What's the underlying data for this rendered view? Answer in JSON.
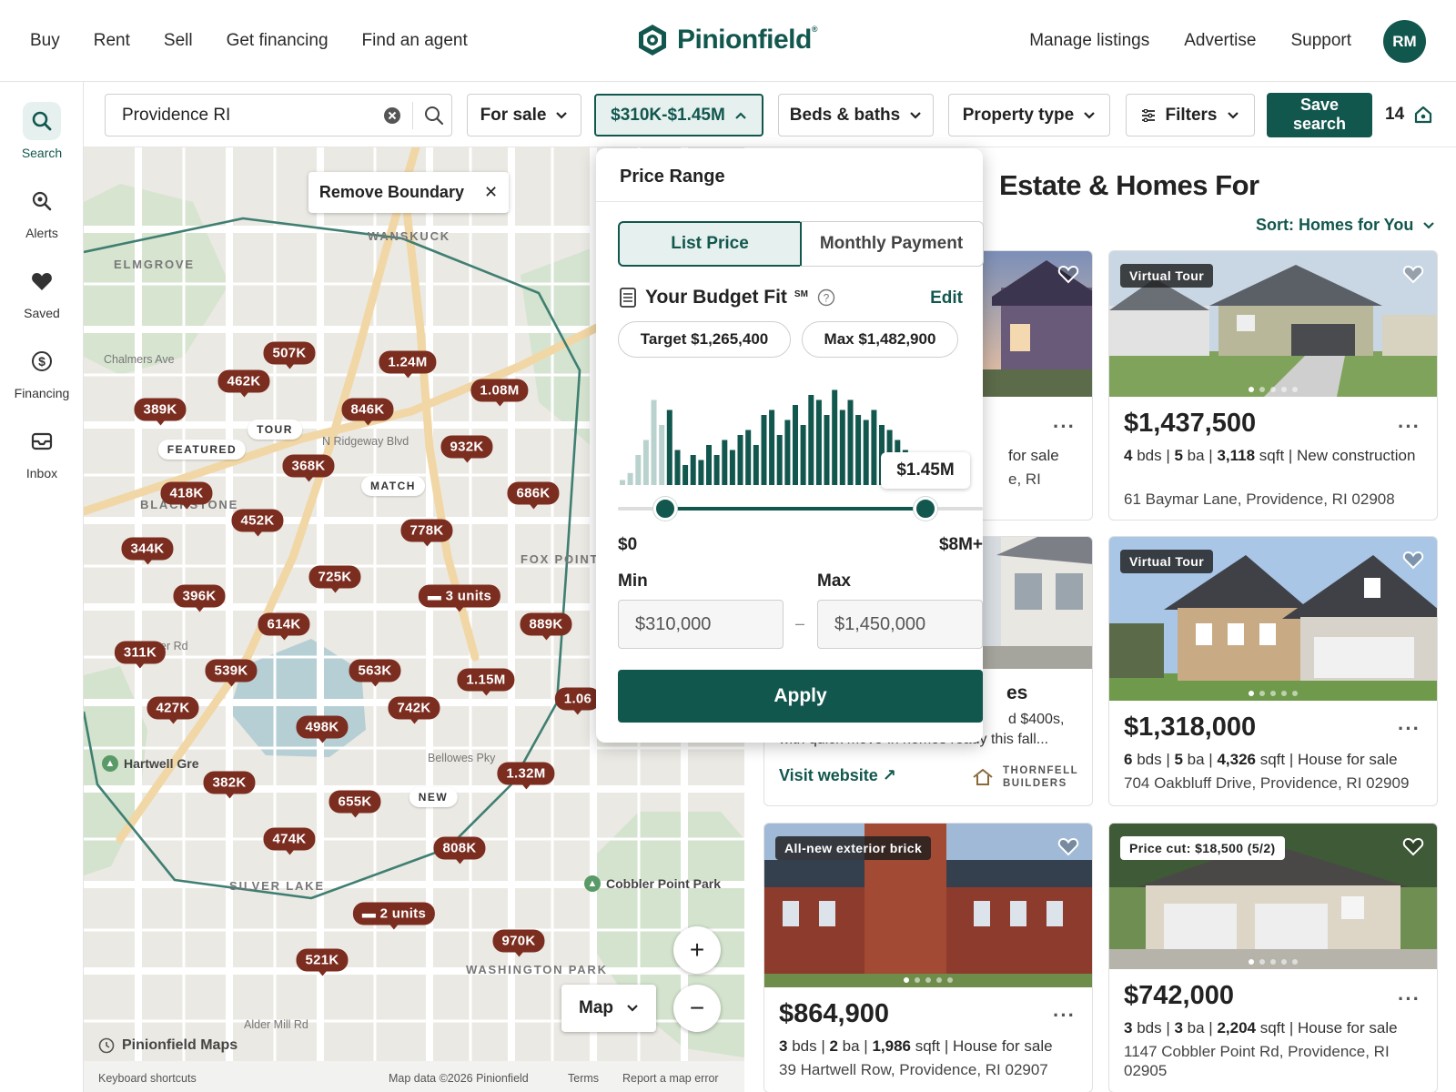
{
  "nav": {
    "left": [
      "Buy",
      "Rent",
      "Sell",
      "Get financing",
      "Find an agent"
    ],
    "right": [
      "Manage listings",
      "Advertise",
      "Support"
    ],
    "brand": "Pinionfield",
    "brand_mark": "®",
    "avatar_initials": "RM"
  },
  "rail": [
    {
      "label": "Search",
      "icon": "search-icon"
    },
    {
      "label": "Alerts",
      "icon": "alerts-icon"
    },
    {
      "label": "Saved",
      "icon": "heart-icon"
    },
    {
      "label": "Financing",
      "icon": "dollar-icon"
    },
    {
      "label": "Inbox",
      "icon": "inbox-icon"
    }
  ],
  "filters": {
    "search_value": "Providence RI",
    "for_sale": "For sale",
    "price": "$310K-$1.45M",
    "beds_baths": "Beds & baths",
    "property_type": "Property type",
    "filters": "Filters",
    "save_search_line1": "Save",
    "save_search_line2": "search",
    "result_count": "14"
  },
  "map": {
    "remove_boundary": "Remove Boundary",
    "map_type": "Map",
    "logo": "Pinionfield Maps",
    "footer": {
      "shortcuts": "Keyboard shortcuts",
      "data": "Map data ©2026 Pinionfield",
      "terms": "Terms",
      "report": "Report a map error"
    },
    "areas": [
      "ELMGROVE",
      "WANSKUCK",
      "BLACKSTONE",
      "FOX POINT",
      "SILVER LAKE",
      "WASHINGTON PARK"
    ],
    "streets": [
      "Chalmers Ave",
      "N Ridgeway Blvd",
      "Bellowes Pky",
      "Alder Mill Rd",
      "er Rd"
    ],
    "parks": [
      "Hartwell Gre",
      "Cobbler Point Park"
    ],
    "pins": [
      "507K",
      "462K",
      "1.24M",
      "1.08M",
      "389K",
      "846K",
      "932K",
      "368K",
      "686K",
      "418K",
      "452K",
      "778K",
      "344K",
      "725K",
      "3 units",
      "396K",
      "614K",
      "889K",
      "311K",
      "539K",
      "563K",
      "1.15M",
      "1.06",
      "427K",
      "742K",
      "498K",
      "1.32M",
      "382K",
      "655K",
      "474K",
      "808K",
      "2 units",
      "970K",
      "521K"
    ],
    "tags": [
      "TOUR",
      "FEATURED",
      "MATCH",
      "NEW"
    ]
  },
  "price_popover": {
    "title": "Price Range",
    "tab_list": "List Price",
    "tab_monthly": "Monthly Payment",
    "budget_label": "Your Budget Fit",
    "budget_sm": "SM",
    "edit": "Edit",
    "target": "Target $1,265,400",
    "max_chip": "Max $1,482,900",
    "tooltip": "$1.45M",
    "axis_min": "$0",
    "axis_max": "$8M+",
    "min_label": "Min",
    "max_label": "Max",
    "min_value": "$310,000",
    "max_value": "$1,450,000",
    "dash": "–",
    "apply": "Apply",
    "range_low_fraction": 0.129,
    "range_high_fraction": 0.842,
    "histogram": [
      0.05,
      0.12,
      0.3,
      0.45,
      0.85,
      0.6,
      0.75,
      0.35,
      0.2,
      0.3,
      0.25,
      0.4,
      0.3,
      0.45,
      0.35,
      0.5,
      0.55,
      0.4,
      0.7,
      0.75,
      0.5,
      0.65,
      0.8,
      0.6,
      0.9,
      0.85,
      0.7,
      0.95,
      0.75,
      0.85,
      0.7,
      0.65,
      0.75,
      0.6,
      0.55,
      0.45,
      0.35,
      0.3,
      0.2,
      0.15,
      0.1,
      0.08,
      0.06,
      0.05
    ]
  },
  "listings": {
    "heading": "Estate & Homes For",
    "sort": "Sort: Homes for You",
    "cards": [
      {
        "price": "",
        "facts": "for sale",
        "addr": "e, RI"
      },
      {
        "badge": "Virtual Tour",
        "price": "$1,437,500",
        "facts_b1": "4",
        "facts_t1": " bds | ",
        "facts_b2": "5",
        "facts_t2": " ba | ",
        "facts_b3": "3,118",
        "facts_t3": " sqft | New construction",
        "addr": "61 Baymar Lane, Providence, RI 02908"
      },
      {
        "promo_title": "es",
        "promo_line1": "d $400s,",
        "promo_line2": "with quick move-in homes ready this fall...",
        "visit": "Visit website ↗",
        "builder": "THORNFELL",
        "builder2": "BUILDERS"
      },
      {
        "badge": "Virtual Tour",
        "price": "$1,318,000",
        "facts_b1": "6",
        "facts_t1": " bds | ",
        "facts_b2": "5",
        "facts_t2": " ba | ",
        "facts_b3": "4,326",
        "facts_t3": " sqft | House for sale",
        "addr": "704 Oakbluff Drive, Providence, RI 02909"
      },
      {
        "badge": "All-new exterior brick",
        "price": "$864,900",
        "facts_b1": "3",
        "facts_t1": " bds | ",
        "facts_b2": "2",
        "facts_t2": " ba | ",
        "facts_b3": "1,986",
        "facts_t3": " sqft | House for sale",
        "addr": "39 Hartwell Row, Providence, RI 02907"
      },
      {
        "badge": "Price cut: $18,500 (5/2)",
        "price": "$742,000",
        "facts_b1": "3",
        "facts_t1": " bds | ",
        "facts_b2": "3",
        "facts_t2": " ba | ",
        "facts_b3": "2,204",
        "facts_t3": " sqft | House for sale",
        "addr": "1147 Cobbler Point Rd, Providence, RI 02905"
      }
    ]
  },
  "colors": {
    "brand": "#12574e",
    "pin": "#7b2d20",
    "map_bg": "#ebe9e3"
  }
}
